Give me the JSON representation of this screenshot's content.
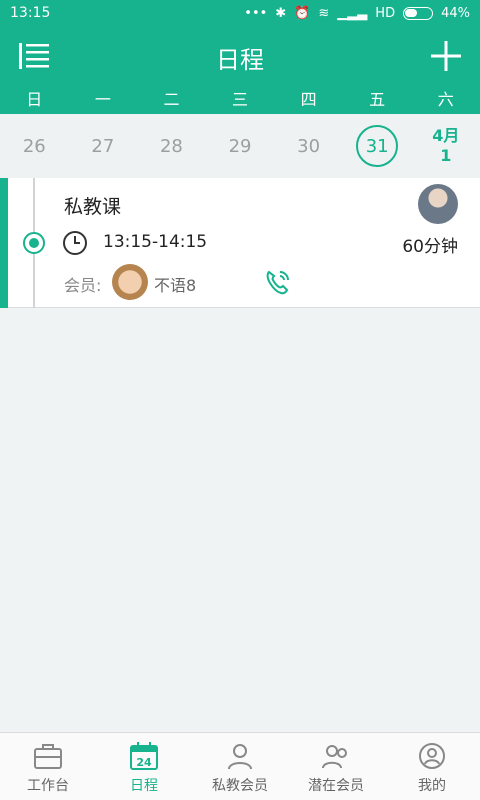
{
  "status_bar": {
    "time": "13:15",
    "network": "HD",
    "battery": "44%"
  },
  "header": {
    "title": "日程"
  },
  "weekdays": [
    "日",
    "一",
    "二",
    "三",
    "四",
    "五",
    "六"
  ],
  "dates": [
    {
      "label": "26",
      "state": "normal"
    },
    {
      "label": "27",
      "state": "normal"
    },
    {
      "label": "28",
      "state": "normal"
    },
    {
      "label": "29",
      "state": "normal"
    },
    {
      "label": "30",
      "state": "normal"
    },
    {
      "label": "31",
      "state": "selected"
    },
    {
      "month": "4月",
      "day": "1",
      "state": "next-month"
    }
  ],
  "event": {
    "title": "私教课",
    "time_range": "13:15-14:15",
    "duration": "60分钟",
    "member_label": "会员:",
    "member_name": "不语8"
  },
  "tabs": [
    {
      "label": "工作台",
      "icon": "briefcase-icon",
      "active": false
    },
    {
      "label": "日程",
      "icon": "calendar-icon",
      "active": true
    },
    {
      "label": "私教会员",
      "icon": "members-icon",
      "active": false
    },
    {
      "label": "潜在会员",
      "icon": "prospects-icon",
      "active": false
    },
    {
      "label": "我的",
      "icon": "profile-icon",
      "active": false
    }
  ],
  "colors": {
    "accent": "#16b38e"
  }
}
